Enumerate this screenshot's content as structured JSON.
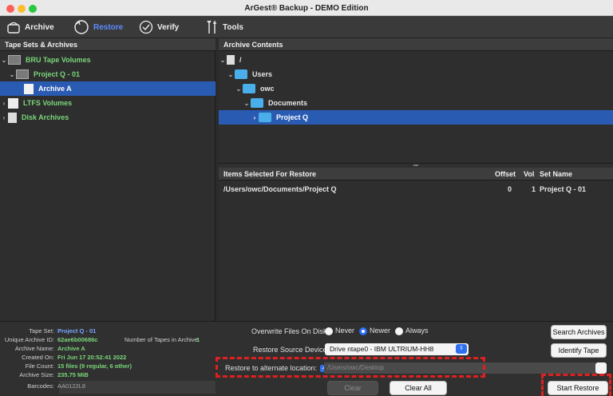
{
  "window": {
    "title": "ArGest® Backup - DEMO Edition"
  },
  "toolbar": {
    "items": [
      {
        "label": "Archive",
        "icon": "archive-icon"
      },
      {
        "label": "Restore",
        "icon": "restore-icon",
        "active": true
      },
      {
        "label": "Verify",
        "icon": "verify-icon"
      },
      {
        "label": "Tools",
        "icon": "tools-icon"
      }
    ]
  },
  "left_pane": {
    "header": "Tape Sets & Archives",
    "tree": [
      {
        "label": "BRU Tape Volumes",
        "icon": "tape-volumes-icon"
      },
      {
        "label": "Project Q - 01",
        "icon": "tape-icon"
      },
      {
        "label": "Archive A",
        "icon": "archive-file-icon",
        "selected": true
      },
      {
        "label": "LTFS Volumes",
        "icon": "ltfs-icon"
      },
      {
        "label": "Disk Archives",
        "icon": "disk-archives-icon"
      }
    ]
  },
  "archive_contents": {
    "header": "Archive Contents",
    "tree": [
      {
        "label": "/",
        "icon": "root-disk-icon"
      },
      {
        "label": "Users",
        "icon": "folder-icon"
      },
      {
        "label": "owc",
        "icon": "folder-icon"
      },
      {
        "label": "Documents",
        "icon": "folder-icon"
      },
      {
        "label": "Project Q",
        "icon": "folder-icon",
        "selected": true
      }
    ]
  },
  "restore_items": {
    "columns": [
      "Items Selected For Restore",
      "Offset",
      "Vol",
      "Set Name"
    ],
    "rows": [
      {
        "path": "/Users/owc/Documents/Project Q",
        "offset": "0",
        "vol": "1",
        "set": "Project Q - 01"
      }
    ]
  },
  "archive_info": {
    "tape_set_label": "Tape Set:",
    "tape_set": "Project Q - 01",
    "uid_label": "Unique Archive ID:",
    "uid": "62ae6b00686c",
    "tapes_label": "Number of Tapes in Archive:",
    "tapes": "1",
    "name_label": "Archive Name:",
    "name": "Archive A",
    "created_label": "Created On:",
    "created": "Fri Jun 17 20:52:41 2022",
    "count_label": "File Count:",
    "count": "15 files (9 regular, 6 other)",
    "size_label": "Archive Size:",
    "size": "235.75 MiB",
    "barcodes_label": "Barcodes:",
    "barcodes": "AA0122L8"
  },
  "restore_options": {
    "overwrite_label": "Overwrite Files On Disk:",
    "overwrite_options": [
      "Never",
      "Newer",
      "Always"
    ],
    "overwrite_selected": "Newer",
    "source_label": "Restore Source Device:",
    "source_value": "Drive ntape0 - IBM ULTRIUM-HH8",
    "alt_label": "Restore to alternate location:",
    "alt_checked": true,
    "alt_path": "/Users/owc/Desktop",
    "search_label": "Search Archives",
    "identify_label": "Identify Tape",
    "clear_sel_label": "Clear Selections",
    "clear_all_label": "Clear All",
    "start_label": "Start Restore"
  },
  "colors": {
    "accent": "#2d6ff0",
    "selection": "#2a5bb3",
    "tree_text": "#7ad67a",
    "highlight": "#e02020"
  }
}
